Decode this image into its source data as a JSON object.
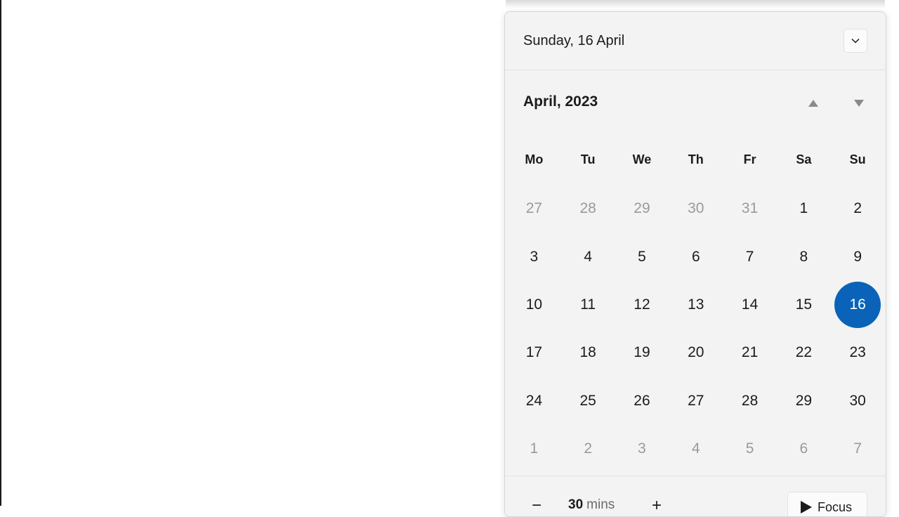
{
  "header": {
    "date": "Sunday, 16 April"
  },
  "calendar": {
    "month_title": "April, 2023",
    "weekdays": [
      "Mo",
      "Tu",
      "We",
      "Th",
      "Fr",
      "Sa",
      "Su"
    ],
    "weeks": [
      [
        {
          "d": "27",
          "m": true
        },
        {
          "d": "28",
          "m": true
        },
        {
          "d": "29",
          "m": true
        },
        {
          "d": "30",
          "m": true
        },
        {
          "d": "31",
          "m": true
        },
        {
          "d": "1"
        },
        {
          "d": "2"
        }
      ],
      [
        {
          "d": "3"
        },
        {
          "d": "4"
        },
        {
          "d": "5"
        },
        {
          "d": "6"
        },
        {
          "d": "7"
        },
        {
          "d": "8"
        },
        {
          "d": "9"
        }
      ],
      [
        {
          "d": "10"
        },
        {
          "d": "11"
        },
        {
          "d": "12"
        },
        {
          "d": "13"
        },
        {
          "d": "14"
        },
        {
          "d": "15"
        },
        {
          "d": "16",
          "s": true
        }
      ],
      [
        {
          "d": "17"
        },
        {
          "d": "18"
        },
        {
          "d": "19"
        },
        {
          "d": "20"
        },
        {
          "d": "21"
        },
        {
          "d": "22"
        },
        {
          "d": "23"
        }
      ],
      [
        {
          "d": "24"
        },
        {
          "d": "25"
        },
        {
          "d": "26"
        },
        {
          "d": "27"
        },
        {
          "d": "28"
        },
        {
          "d": "29"
        },
        {
          "d": "30"
        }
      ],
      [
        {
          "d": "1",
          "m": true
        },
        {
          "d": "2",
          "m": true
        },
        {
          "d": "3",
          "m": true
        },
        {
          "d": "4",
          "m": true
        },
        {
          "d": "5",
          "m": true
        },
        {
          "d": "6",
          "m": true
        },
        {
          "d": "7",
          "m": true
        }
      ]
    ],
    "selected_color": "#0a63b8"
  },
  "focus": {
    "minus_label": "−",
    "plus_label": "+",
    "duration_value": "30",
    "duration_unit": "mins",
    "button_label": "Focus"
  },
  "icons": {
    "collapse": "chevron-down-icon",
    "prev_month": "triangle-up-icon",
    "next_month": "triangle-down-icon",
    "focus": "play-icon"
  }
}
